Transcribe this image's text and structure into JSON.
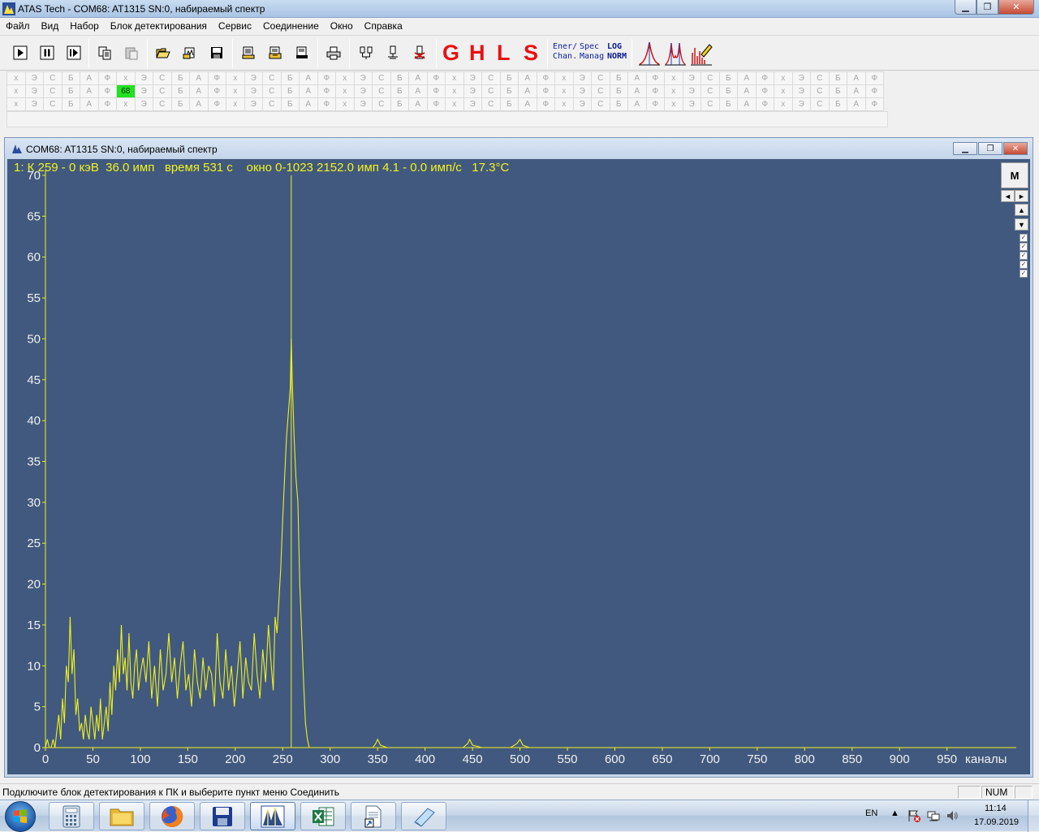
{
  "window": {
    "title": "ATAS Tech   - COM68: AT1315 SN:0, набираемый спектр",
    "minimize": "▁",
    "maximize": "❐",
    "close": "✕"
  },
  "menu": [
    "Файл",
    "Вид",
    "Набор",
    "Блок детектирования",
    "Сервис",
    "Соединение",
    "Окно",
    "Справка"
  ],
  "toolbar": {
    "g": "G",
    "h": "H",
    "l": "L",
    "s": "S",
    "ener_chan_top": "Ener/",
    "ener_chan_bottom": "Chan.",
    "spec_manag_top": "Spec",
    "spec_manag_bottom": "Manag",
    "log_norm_top": "LOG",
    "log_norm_bottom": "NORM"
  },
  "detector_grid": {
    "cycle": [
      "х",
      "Э",
      "С",
      "Б",
      "А",
      "Ф"
    ],
    "columns": 48,
    "rows": 3,
    "active_cell_label": "68"
  },
  "child": {
    "title": "COM68: AT1315 SN:0, набираемый спектр",
    "info": "1: К 259 - 0 кэВ  36.0 имп   время 531 с    окно 0-1023 2152.0 имп 4.1 - 0.0 имп/с   17.3°C",
    "m_button": "M",
    "left_arrow": "◄",
    "right_arrow": "►",
    "up_arrow": "▲",
    "down_arrow": "▼",
    "check_mark": "✓"
  },
  "chart_data": {
    "type": "line",
    "xlabel": "каналы",
    "xlim": [
      0,
      1023
    ],
    "ylim": [
      0,
      70
    ],
    "x_ticks": [
      0,
      50,
      100,
      150,
      200,
      250,
      300,
      350,
      400,
      450,
      500,
      550,
      600,
      650,
      700,
      750,
      800,
      850,
      900,
      950
    ],
    "y_ticks": [
      0,
      5,
      10,
      15,
      20,
      25,
      30,
      35,
      40,
      45,
      50,
      55,
      60,
      65,
      70
    ],
    "cursor_channel": 259,
    "line_color": "#f0f020",
    "background": "#41597e",
    "series": [
      {
        "x": [
          0,
          2,
          4,
          6,
          8,
          10,
          12,
          14,
          16,
          18,
          20,
          22,
          24,
          26,
          28,
          30,
          32,
          34,
          36,
          38,
          40,
          42,
          44,
          46,
          48,
          50,
          52,
          54,
          56,
          58,
          60,
          62,
          64,
          66,
          68,
          70,
          72,
          74,
          76,
          78,
          80,
          82,
          84,
          86,
          88,
          90,
          92,
          94,
          96,
          98,
          100,
          103,
          106,
          109,
          112,
          115,
          118,
          121,
          124,
          127,
          130,
          133,
          136,
          139,
          142,
          145,
          148,
          151,
          154,
          157,
          160,
          163,
          166,
          169,
          172,
          175,
          178,
          181,
          184,
          187,
          190,
          193,
          196,
          199,
          202,
          205,
          208,
          211,
          214,
          217,
          220,
          223,
          226,
          229,
          232,
          235,
          238,
          240,
          242,
          244,
          246,
          248,
          250,
          252,
          254,
          256,
          258,
          259,
          260,
          262,
          264,
          266,
          268,
          270,
          272,
          274,
          276,
          278,
          280,
          300,
          330,
          345,
          348,
          350,
          353,
          360,
          400,
          440,
          445,
          447,
          450,
          460,
          490,
          497,
          500,
          503,
          510,
          560,
          600,
          700,
          800,
          900,
          1000,
          1023
        ],
        "y": [
          0,
          1,
          0,
          0,
          1,
          0,
          2,
          4,
          1,
          6,
          3,
          10,
          8,
          16,
          9,
          12,
          4,
          6,
          2,
          3,
          1,
          4,
          2,
          1,
          5,
          3,
          1,
          4,
          2,
          6,
          1,
          3,
          5,
          2,
          8,
          4,
          10,
          7,
          12,
          8,
          15,
          9,
          11,
          7,
          14,
          8,
          6,
          10,
          12,
          7,
          9,
          11,
          8,
          13,
          6,
          10,
          5,
          12,
          7,
          9,
          14,
          8,
          11,
          6,
          10,
          13,
          7,
          9,
          5,
          12,
          8,
          6,
          11,
          7,
          10,
          9,
          5,
          14,
          8,
          6,
          12,
          7,
          10,
          5,
          9,
          13,
          6,
          11,
          8,
          7,
          14,
          9,
          6,
          12,
          8,
          15,
          10,
          7,
          16,
          14,
          18,
          22,
          28,
          33,
          38,
          41,
          44,
          50,
          45,
          38,
          33,
          30,
          20,
          14,
          8,
          3,
          1,
          0,
          0,
          0,
          0,
          0,
          0.5,
          1,
          0.3,
          0,
          0,
          0,
          0.5,
          1,
          0.3,
          0,
          0,
          0.5,
          1,
          0.3,
          0,
          0,
          0,
          0,
          0,
          0,
          0,
          0
        ]
      }
    ]
  },
  "status": {
    "message": "Подключите блок детектирования к ПК и выберите пункт меню Соединить",
    "num": "NUM"
  },
  "taskbar": {
    "lang": "EN",
    "time": "11:14",
    "date": "17.09.2019"
  }
}
